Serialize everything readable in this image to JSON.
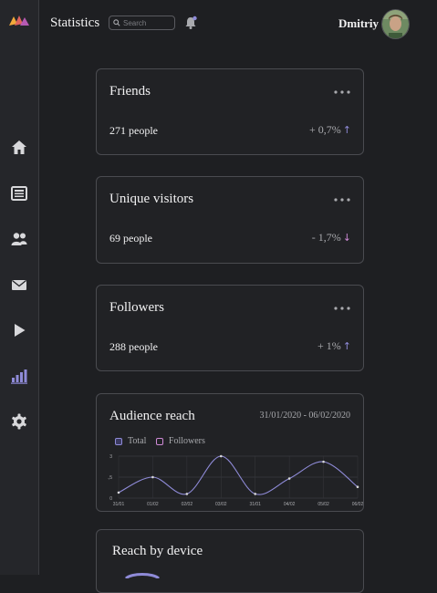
{
  "header": {
    "title": "Statistics",
    "search_placeholder": "Search",
    "user_name": "Dmitriy"
  },
  "sidebar": {
    "items": [
      {
        "icon": "home-icon"
      },
      {
        "icon": "newspaper-icon"
      },
      {
        "icon": "users-icon"
      },
      {
        "icon": "mail-icon"
      },
      {
        "icon": "play-icon"
      },
      {
        "icon": "bar-chart-icon",
        "active": true
      },
      {
        "icon": "gear-icon"
      }
    ]
  },
  "colors": {
    "accent": "#8f8bd8",
    "accent_pink": "#cf8ad6",
    "background": "#1e1f22",
    "card": "#212225"
  },
  "cards": [
    {
      "title": "Friends",
      "value": "271 people",
      "change": "+ 0,7%",
      "direction": "up"
    },
    {
      "title": "Unique visitors",
      "value": "69 people",
      "change": "- 1,7%",
      "direction": "down"
    },
    {
      "title": "Followers",
      "value": "288 people",
      "change": "+ 1%",
      "direction": "up"
    }
  ],
  "audience": {
    "title": "Audience reach",
    "date_range": "31/01/2020 - 06/02/2020",
    "legend": [
      "Total",
      "Followers"
    ]
  },
  "device": {
    "title": "Reach by device"
  },
  "chart_data": {
    "type": "line",
    "x": [
      "31/01",
      "01/02",
      "02/02",
      "03/02",
      "31/01",
      "04/02",
      "05/02",
      "06/02"
    ],
    "series": [
      {
        "name": "Total",
        "values": [
          0.4,
          1.5,
          0.3,
          3,
          0.3,
          1.4,
          2.6,
          0.8
        ]
      }
    ],
    "yticks": [
      "0",
      "1,5",
      "3"
    ],
    "ylim": [
      0,
      3
    ],
    "grid": true,
    "legend": "top-left"
  }
}
